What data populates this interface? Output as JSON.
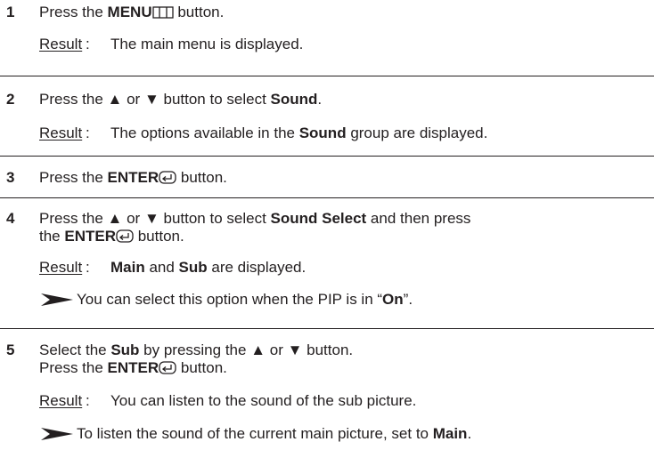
{
  "steps": [
    {
      "number": "1",
      "lines": [
        {
          "pre": "Press the ",
          "bold": "MENU",
          "icon": "menu-icon",
          "post": " button."
        }
      ],
      "result_label": "Result",
      "result_colon": ":",
      "result_text": "The main menu is displayed."
    },
    {
      "number": "2",
      "line_pre": "Press the ",
      "up": "▲",
      "or": " or ",
      "down": "▼",
      "line_mid": " button to select ",
      "bold": "Sound",
      "line_post": ".",
      "result_label": "Result",
      "result_colon": ":",
      "result_pre": "The options available in the ",
      "result_bold": "Sound",
      "result_post": " group are displayed."
    },
    {
      "number": "3",
      "pre": "Press the ",
      "bold": "ENTER",
      "icon": "enter-icon",
      "post": " button."
    },
    {
      "number": "4",
      "line1_pre": "Press the ",
      "up": "▲",
      "or": " or ",
      "down": "▼",
      "line1_mid": " button to select ",
      "line1_bold": "Sound Select",
      "line1_post": " and then press",
      "line2_pre": "the ",
      "line2_bold": "ENTER",
      "line2_icon": "enter-icon",
      "line2_post": " button.",
      "result_label": "Result",
      "result_colon": ":",
      "result_bold1": "Main",
      "result_mid": " and ",
      "result_bold2": "Sub",
      "result_post": " are displayed.",
      "note_icon": "note-arrow-icon",
      "note_pre": "You can select this option when the PIP is in “",
      "note_bold": "On",
      "note_post": "”."
    },
    {
      "number": "5",
      "line1_pre": "Select the ",
      "line1_bold": "Sub",
      "line1_mid": " by pressing the ",
      "up": "▲",
      "or": " or ",
      "down": "▼",
      "line1_post": " button.",
      "line2_pre": "Press the ",
      "line2_bold": "ENTER",
      "line2_icon": "enter-icon",
      "line2_post": " button.",
      "result_label": "Result",
      "result_colon": ":",
      "result_text": "You can listen to the sound of the sub picture.",
      "note_icon": "note-arrow-icon",
      "note_pre": "To listen the sound of the current main picture, set to ",
      "note_bold": "Main",
      "note_post": "."
    }
  ]
}
